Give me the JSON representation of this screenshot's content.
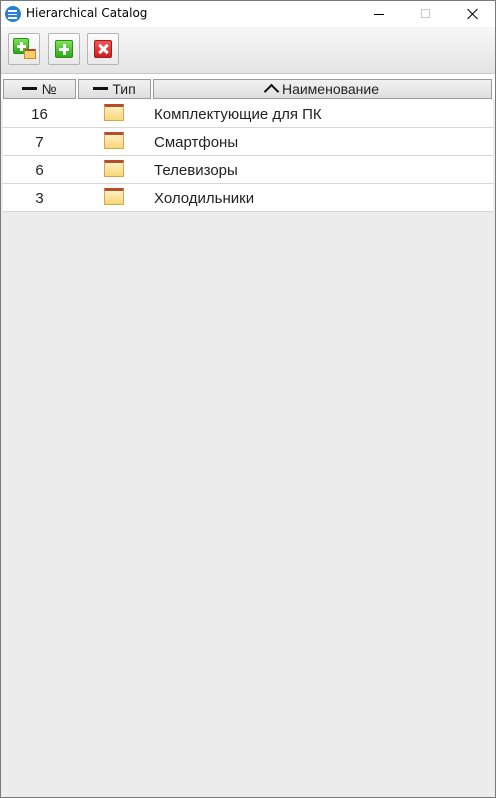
{
  "window": {
    "title": "Hierarchical Catalog",
    "icon": "list-icon"
  },
  "toolbar": {
    "buttons": [
      {
        "icon": "add-folder-icon"
      },
      {
        "icon": "add-icon"
      },
      {
        "icon": "delete-icon"
      }
    ]
  },
  "grid": {
    "columns": [
      {
        "label": "№",
        "sort": "none"
      },
      {
        "label": "Тип",
        "sort": "none"
      },
      {
        "label": "Наименование",
        "sort": "ascending"
      }
    ],
    "rows": [
      {
        "num": "16",
        "type": "folder-icon",
        "name": "Комплектующие для ПК"
      },
      {
        "num": "7",
        "type": "folder-icon",
        "name": "Смартфоны"
      },
      {
        "num": "6",
        "type": "folder-icon",
        "name": "Телевизоры"
      },
      {
        "num": "3",
        "type": "folder-icon",
        "name": "Холодильники"
      }
    ]
  },
  "colors": {
    "accent": "#2b7fd9",
    "add": "#3cb520",
    "delete": "#dd2a2a",
    "folder": "#f9d679"
  }
}
